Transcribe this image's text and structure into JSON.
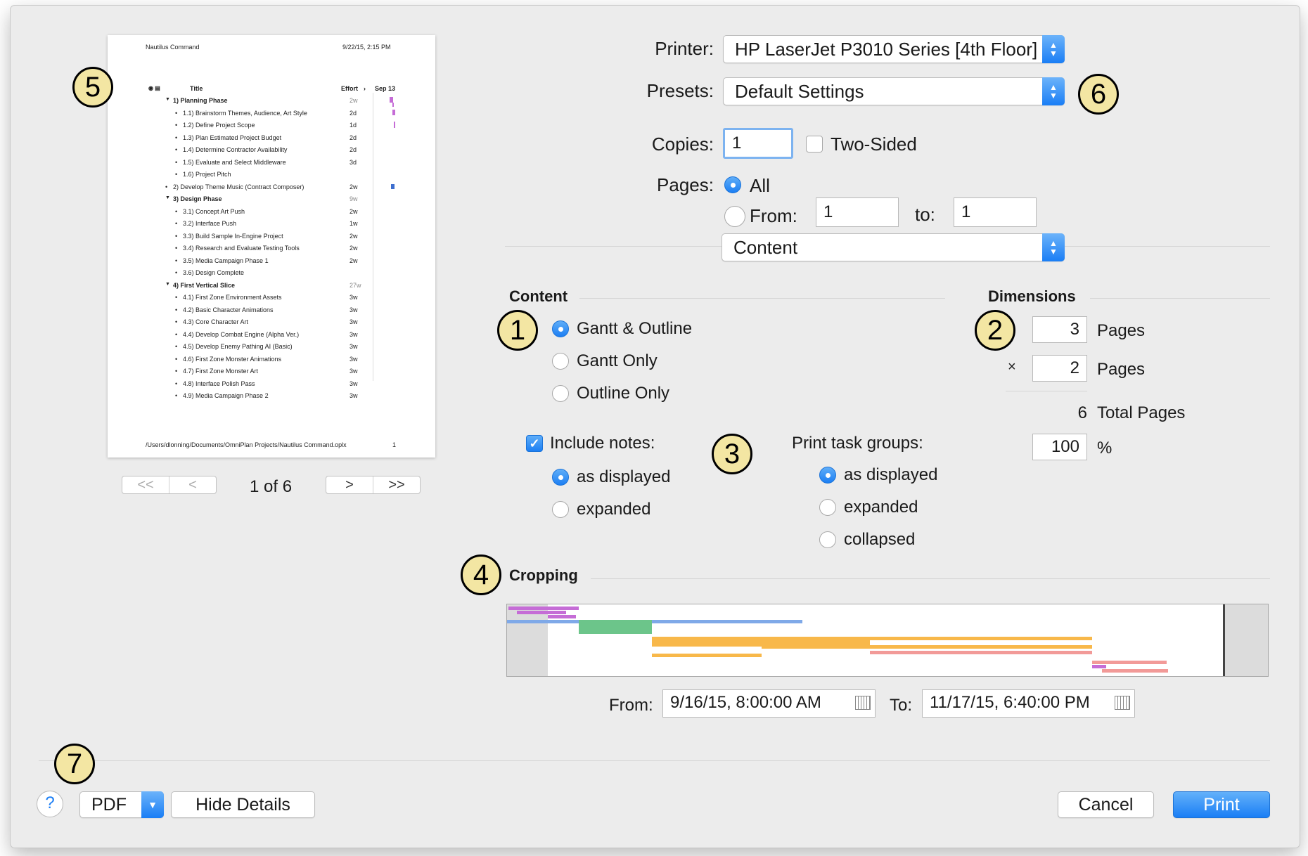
{
  "preview": {
    "project_title": "Nautilus Command",
    "printed_at": "9/22/15, 2:15 PM",
    "columns": {
      "title": "Title",
      "effort": "Effort",
      "date": "Sep 13"
    },
    "rows": [
      {
        "label": "1)  Planning Phase",
        "effort": "2w",
        "level": 0,
        "group": true
      },
      {
        "label": "1.1)  Brainstorm Themes, Audience, Art Style",
        "effort": "2d",
        "level": 1
      },
      {
        "label": "1.2)  Define Project Scope",
        "effort": "1d",
        "level": 1
      },
      {
        "label": "1.3)  Plan Estimated Project Budget",
        "effort": "2d",
        "level": 1
      },
      {
        "label": "1.4)  Determine Contractor Availability",
        "effort": "2d",
        "level": 1
      },
      {
        "label": "1.5)  Evaluate and Select Middleware",
        "effort": "3d",
        "level": 1
      },
      {
        "label": "1.6)  Project Pitch",
        "effort": "",
        "level": 1
      },
      {
        "label": "2)  Develop Theme Music (Contract Composer)",
        "effort": "2w",
        "level": 0
      },
      {
        "label": "3)  Design Phase",
        "effort": "9w",
        "level": 0,
        "group": true
      },
      {
        "label": "3.1)  Concept Art Push",
        "effort": "2w",
        "level": 1
      },
      {
        "label": "3.2)  Interface Push",
        "effort": "1w",
        "level": 1
      },
      {
        "label": "3.3)  Build Sample In-Engine Project",
        "effort": "2w",
        "level": 1
      },
      {
        "label": "3.4)  Research and Evaluate Testing Tools",
        "effort": "2w",
        "level": 1
      },
      {
        "label": "3.5)  Media Campaign Phase 1",
        "effort": "2w",
        "level": 1
      },
      {
        "label": "3.6)  Design Complete",
        "effort": "",
        "level": 1
      },
      {
        "label": "4)  First Vertical Slice",
        "effort": "27w",
        "level": 0,
        "group": true
      },
      {
        "label": "4.1)  First Zone Environment Assets",
        "effort": "3w",
        "level": 1
      },
      {
        "label": "4.2)  Basic Character Animations",
        "effort": "3w",
        "level": 1
      },
      {
        "label": "4.3)  Core Character Art",
        "effort": "3w",
        "level": 1
      },
      {
        "label": "4.4)  Develop Combat Engine (Alpha Ver.)",
        "effort": "3w",
        "level": 1
      },
      {
        "label": "4.5)  Develop Enemy Pathing AI (Basic)",
        "effort": "3w",
        "level": 1
      },
      {
        "label": "4.6)  First Zone Monster Animations",
        "effort": "3w",
        "level": 1
      },
      {
        "label": "4.7)  First Zone Monster Art",
        "effort": "3w",
        "level": 1
      },
      {
        "label": "4.8)  Interface Polish Pass",
        "effort": "3w",
        "level": 1
      },
      {
        "label": "4.9)  Media Campaign Phase 2",
        "effort": "3w",
        "level": 1
      }
    ],
    "footer_path": "/Users/dlonning/Documents/OmniPlan Projects/Nautilus Command.oplx",
    "footer_page": "1",
    "nav": {
      "first": "<<",
      "prev": "<",
      "next": ">",
      "last": ">>",
      "page_indicator": "1 of 6"
    }
  },
  "printer": {
    "label": "Printer:",
    "value": "HP LaserJet P3010 Series [4th Floor]"
  },
  "presets": {
    "label": "Presets:",
    "value": "Default Settings"
  },
  "copies": {
    "label": "Copies:",
    "value": "1",
    "two_sided_label": "Two-Sided",
    "two_sided": false
  },
  "pages": {
    "label": "Pages:",
    "all_label": "All",
    "from_label": "From:",
    "from_value": "1",
    "to_label": "to:",
    "to_value": "1",
    "selected": "all"
  },
  "panel_select": {
    "value": "Content"
  },
  "content": {
    "header": "Content",
    "options": [
      "Gantt & Outline",
      "Gantt Only",
      "Outline Only"
    ],
    "selected": "Gantt & Outline",
    "include_notes_label": "Include notes:",
    "include_notes": true,
    "notes_options": [
      "as displayed",
      "expanded"
    ],
    "notes_selected": "as displayed",
    "task_groups_label": "Print task groups:",
    "task_group_options": [
      "as displayed",
      "expanded",
      "collapsed"
    ],
    "task_group_selected": "as displayed"
  },
  "dimensions": {
    "header": "Dimensions",
    "pages_wide": "3",
    "pages_tall": "2",
    "pages_unit": "Pages",
    "times": "×",
    "total_count": "6",
    "total_label": "Total Pages",
    "scale": "100",
    "percent": "%"
  },
  "cropping": {
    "header": "Cropping",
    "from_label": "From:",
    "from_value": "9/16/15, 8:00:00 AM",
    "to_label": "To:",
    "to_value": "11/17/15, 6:40:00 PM"
  },
  "footer": {
    "help": "?",
    "pdf": "PDF",
    "hide_details": "Hide Details",
    "cancel": "Cancel",
    "print": "Print"
  },
  "callouts": [
    "1",
    "2",
    "3",
    "4",
    "5",
    "6",
    "7"
  ],
  "colors": {
    "accent": "#1a7ef5",
    "callout_fill": "#f3e6a3",
    "gantt_orange": "#f8b84a",
    "gantt_green": "#6cc58a",
    "gantt_pink": "#f29a98",
    "gantt_purple": "#c56cd6",
    "gantt_blue": "#7fa9e8"
  }
}
